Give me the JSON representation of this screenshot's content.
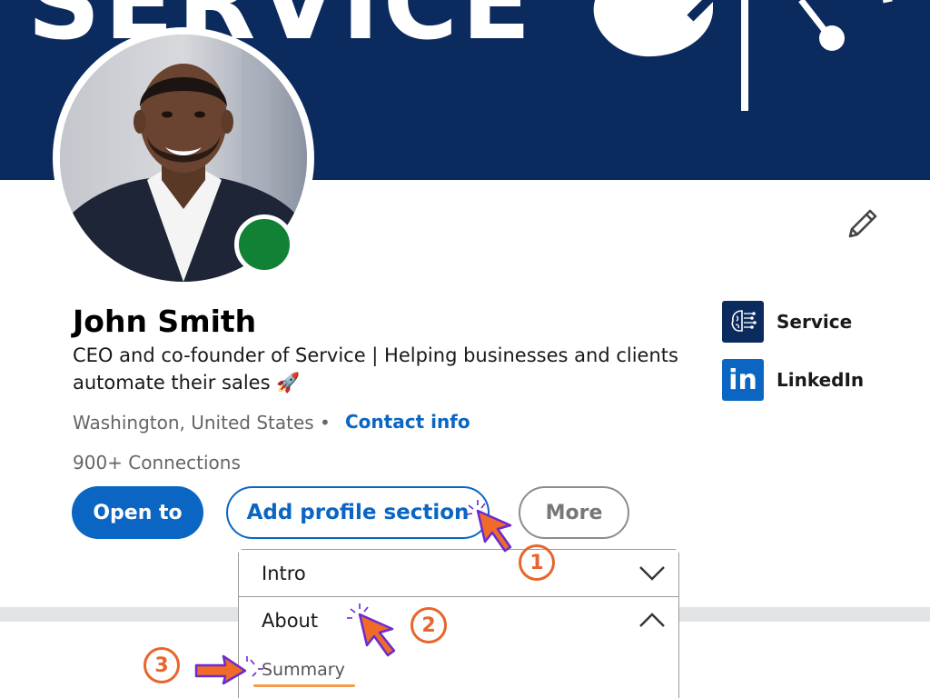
{
  "banner": {
    "text": "SERVICE"
  },
  "profile": {
    "name": "John Smith",
    "headline": "CEO and co-founder of Service | Helping businesses and clients automate their sales 🚀",
    "location": "Washington, United States •",
    "contact_link": "Contact info",
    "connections": "900+ Connections",
    "status": "online"
  },
  "actions": {
    "open_to": "Open to",
    "add_section": "Add profile section",
    "more": "More"
  },
  "companies": [
    {
      "label": "Service",
      "icon": "brain-circuit-icon"
    },
    {
      "label": "LinkedIn",
      "icon": "linkedin-logo",
      "logo_text": "in"
    }
  ],
  "dropdown": {
    "items": [
      {
        "label": "Intro",
        "state": "collapsed",
        "icon": "chevron-down-icon"
      },
      {
        "label": "About",
        "state": "expanded",
        "icon": "chevron-up-icon"
      }
    ],
    "sub_item": "Summary"
  },
  "steps": [
    "1",
    "2",
    "3"
  ],
  "colors": {
    "brand_blue": "#0a66c2",
    "banner_navy": "#0b2a5e",
    "online_green": "#118235",
    "step_orange": "#e8652c",
    "cursor_fill": "#f06a2a",
    "cursor_outline": "#6a2bd0"
  }
}
